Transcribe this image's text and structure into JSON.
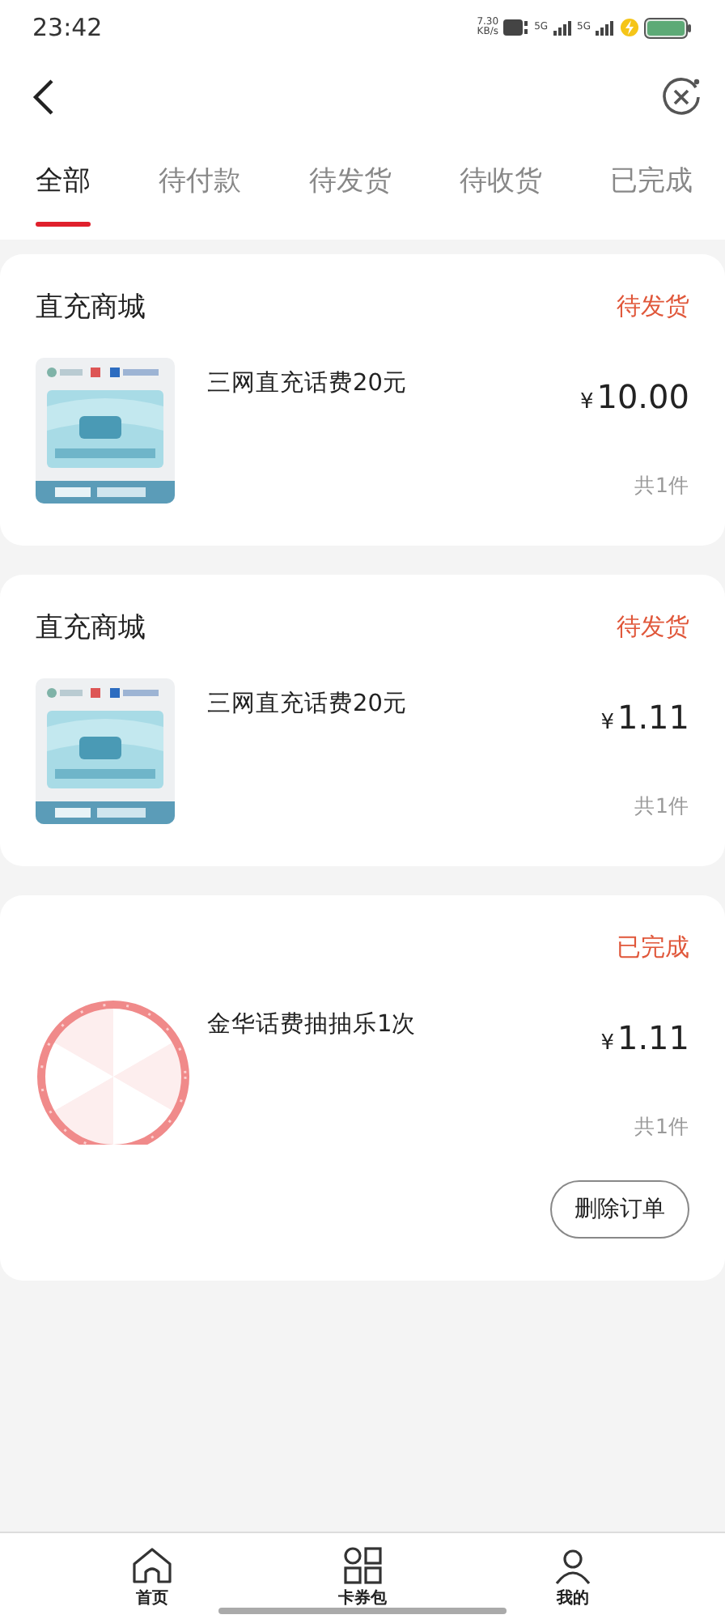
{
  "status_bar": {
    "time": "23:42",
    "net_speed": "7.30",
    "net_unit": "KB/s",
    "networks": [
      "5G",
      "5G"
    ]
  },
  "tabs": [
    {
      "label": "全部",
      "selected": true
    },
    {
      "label": "待付款",
      "selected": false
    },
    {
      "label": "待发货",
      "selected": false
    },
    {
      "label": "待收货",
      "selected": false
    },
    {
      "label": "已完成",
      "selected": false
    }
  ],
  "orders": [
    {
      "store": "直充商城",
      "status": "待发货",
      "product": {
        "kind": "voucher",
        "name": "三网直充话费20元",
        "currency": "¥",
        "price": "10.00",
        "count": "共1件"
      }
    },
    {
      "store": "直充商城",
      "status": "待发货",
      "product": {
        "kind": "voucher",
        "name": "三网直充话费20元",
        "currency": "¥",
        "price": "1.11",
        "count": "共1件"
      }
    },
    {
      "status": "已完成",
      "product": {
        "kind": "wheel",
        "name": "金华话费抽抽乐1次",
        "currency": "¥",
        "price": "1.11",
        "count": "共1件"
      },
      "actions": [
        "删除订单"
      ]
    }
  ],
  "bottom_nav": [
    {
      "label": "首页",
      "kind": "home"
    },
    {
      "label": "卡券包",
      "kind": "grid"
    },
    {
      "label": "我的",
      "kind": "person"
    }
  ]
}
